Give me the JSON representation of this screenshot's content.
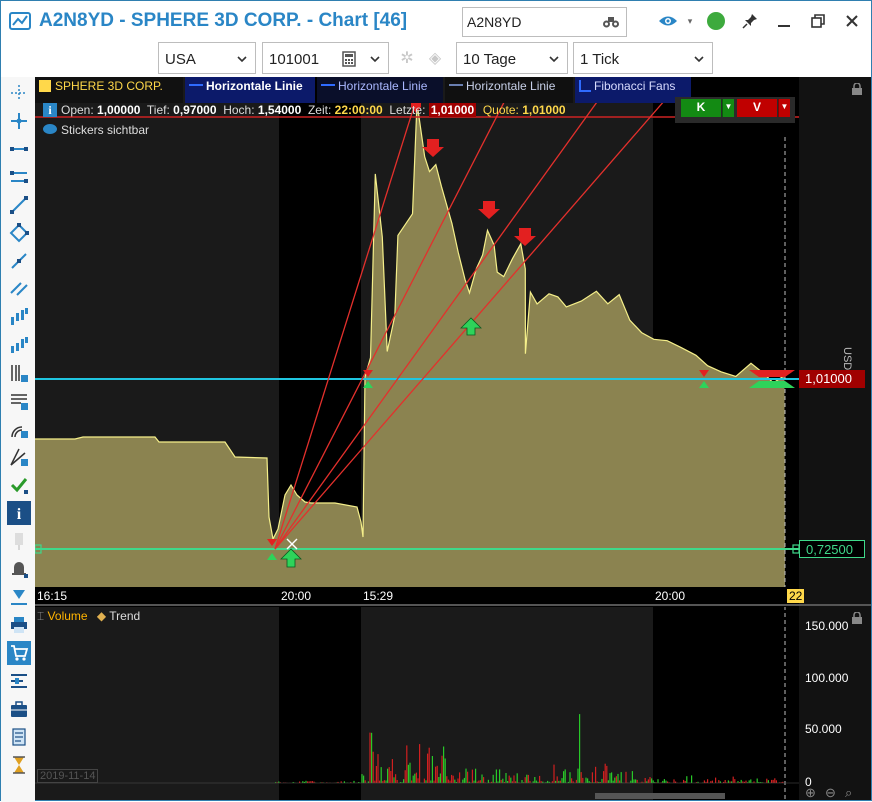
{
  "window": {
    "title": "A2N8YD - SPHERE 3D CORP. - Chart [46]",
    "symbol_value": "A2N8YD"
  },
  "toolbar": {
    "exchange": "USA",
    "code": "101001",
    "period": "10 Tage",
    "interval": "1 Tick"
  },
  "stripes": [
    {
      "label": "SPHERE 3D CORP.",
      "color": "#ffd84a"
    },
    {
      "label": "Horizontale Linie",
      "color": "#ffffff"
    },
    {
      "label": "Horizontale Linie",
      "color": "#aab8ff"
    },
    {
      "label": "Horizontale Linie",
      "color": "#c8d0e8"
    },
    {
      "label": "Fibonacci Fans",
      "color": "#d8dcff"
    }
  ],
  "info": {
    "open_label": "Open:",
    "open_value": "1,00000",
    "low_label": "Tief:",
    "low_value": "0,97000",
    "high_label": "Hoch:",
    "high_value": "1,54000",
    "time_label": "Zeit:",
    "time_value": "22:00:00",
    "last_label": "Letzte:",
    "last_value": "1,01000",
    "quote_label": "Quote:",
    "quote_value": "1,01000",
    "stickers": "Stickers sichtbar"
  },
  "trade_buttons": {
    "buy": "K",
    "sell": "V"
  },
  "price_labels": {
    "upper": "1,01000",
    "lower": "0,72500"
  },
  "currency": "USD",
  "time_axis": [
    "16:15",
    "20:00",
    "15:29",
    "20:00",
    "22"
  ],
  "date_stamp": "2019-11-14",
  "volume_panel": {
    "volume_label": "Volume",
    "trend_label": "Trend",
    "scale": [
      "150.000",
      "100.000",
      "50.000",
      "0"
    ]
  },
  "colors": {
    "accent": "#2a86c6",
    "price_fill": "#8b8350",
    "price_line": "#f5ef8a",
    "cyan_line": "#1fc6e0",
    "green_line": "#3fd98a",
    "fib": "#e3302c"
  },
  "icons": {
    "view": "eye-icon",
    "status": "status-dot-icon",
    "pin": "pin-icon",
    "minimize": "minimize-icon",
    "restore": "restore-icon",
    "close": "close-icon"
  }
}
